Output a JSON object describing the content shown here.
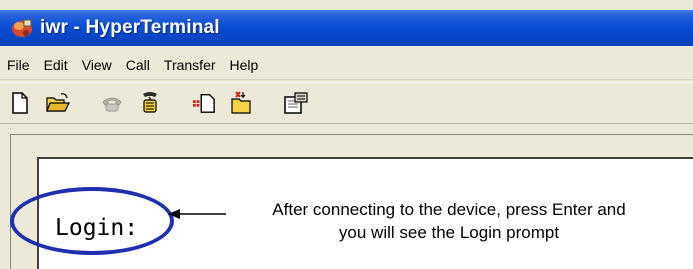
{
  "window": {
    "title": "iwr - HyperTerminal"
  },
  "menubar": {
    "items": [
      {
        "label": "File"
      },
      {
        "label": "Edit"
      },
      {
        "label": "View"
      },
      {
        "label": "Call"
      },
      {
        "label": "Transfer"
      },
      {
        "label": "Help"
      }
    ]
  },
  "toolbar": {
    "buttons": [
      {
        "icon": "new-document-icon"
      },
      {
        "icon": "open-folder-icon"
      },
      {
        "icon": "phone-connect-icon"
      },
      {
        "icon": "disconnect-icon"
      },
      {
        "icon": "send-file-icon"
      },
      {
        "icon": "receive-file-icon"
      },
      {
        "icon": "properties-icon"
      }
    ]
  },
  "terminal": {
    "prompt": "Login:"
  },
  "annotation": {
    "line1": "After connecting to the device, press Enter and",
    "line2": "you will see the Login prompt",
    "color": "#1f2fb0"
  }
}
